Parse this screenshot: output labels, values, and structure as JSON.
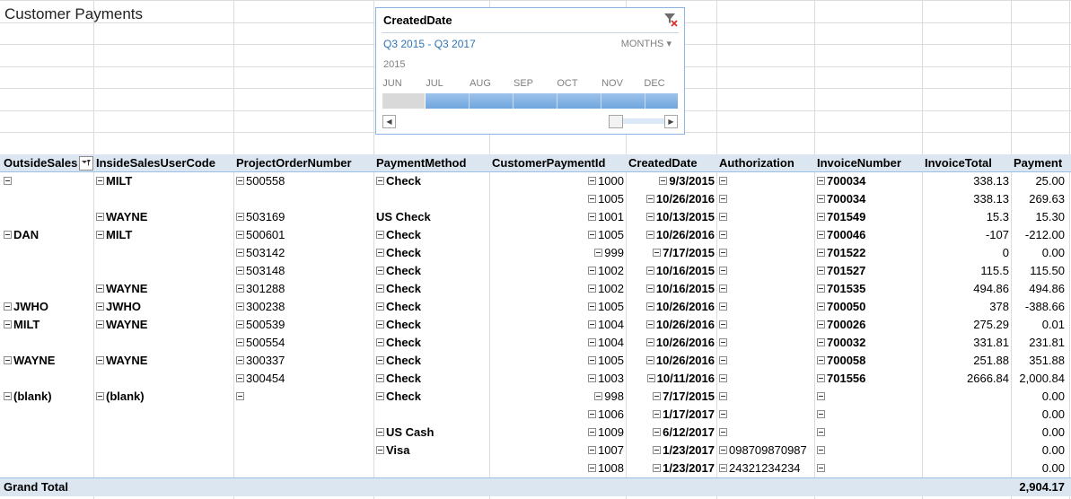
{
  "sheet": {
    "title": "Customer Payments"
  },
  "slicer": {
    "header": "CreatedDate",
    "range_label": "Q3 2015 - Q3 2017",
    "time_level": "MONTHS",
    "year": "2015",
    "months": [
      "JUN",
      "JUL",
      "AUG",
      "SEP",
      "OCT",
      "NOV",
      "DEC"
    ]
  },
  "pivot": {
    "headers": [
      "OutsideSales",
      "InsideSalesUserCode",
      "ProjectOrderNumber",
      "PaymentMethod",
      "CustomerPaymentId",
      "CreatedDate",
      "Authorization",
      "InvoiceNumber",
      "InvoiceTotal",
      "Payment"
    ],
    "rows": [
      {
        "outside": "",
        "outside_exp": true,
        "inside": "MILT",
        "inside_exp": true,
        "order": "500558",
        "order_exp": true,
        "method": "Check",
        "method_exp": true,
        "pid": "1000",
        "date": "9/3/2015",
        "auth": "",
        "auth_exp": true,
        "invoice": "700034",
        "invoice_exp": true,
        "total": "338.13",
        "payment": "25.00"
      },
      {
        "outside": "",
        "outside_exp": false,
        "inside": "",
        "inside_exp": false,
        "order": "",
        "order_exp": false,
        "method": "",
        "method_exp": false,
        "pid": "1005",
        "date": "10/26/2016",
        "auth": "",
        "auth_exp": true,
        "invoice": "700034",
        "invoice_exp": true,
        "total": "338.13",
        "payment": "269.63"
      },
      {
        "outside": "",
        "outside_exp": false,
        "inside": "WAYNE",
        "inside_exp": true,
        "order": "503169",
        "order_exp": true,
        "method": "US Check",
        "method_exp": false,
        "pid": "1001",
        "date": "10/13/2015",
        "auth": "",
        "auth_exp": true,
        "invoice": "701549",
        "invoice_exp": true,
        "total": "15.3",
        "payment": "15.30"
      },
      {
        "outside": "DAN",
        "outside_exp": true,
        "inside": "MILT",
        "inside_exp": true,
        "order": "500601",
        "order_exp": true,
        "method": "Check",
        "method_exp": true,
        "pid": "1005",
        "date": "10/26/2016",
        "auth": "",
        "auth_exp": true,
        "invoice": "700046",
        "invoice_exp": true,
        "total": "-107",
        "payment": "-212.00"
      },
      {
        "outside": "",
        "outside_exp": false,
        "inside": "",
        "inside_exp": false,
        "order": "503142",
        "order_exp": true,
        "method": "Check",
        "method_exp": true,
        "pid": "999",
        "date": "7/17/2015",
        "auth": "",
        "auth_exp": true,
        "invoice": "701522",
        "invoice_exp": true,
        "total": "0",
        "payment": "0.00"
      },
      {
        "outside": "",
        "outside_exp": false,
        "inside": "",
        "inside_exp": false,
        "order": "503148",
        "order_exp": true,
        "method": "Check",
        "method_exp": true,
        "pid": "1002",
        "date": "10/16/2015",
        "auth": "",
        "auth_exp": true,
        "invoice": "701527",
        "invoice_exp": true,
        "total": "115.5",
        "payment": "115.50"
      },
      {
        "outside": "",
        "outside_exp": false,
        "inside": "WAYNE",
        "inside_exp": true,
        "order": "301288",
        "order_exp": true,
        "method": "Check",
        "method_exp": true,
        "pid": "1002",
        "date": "10/16/2015",
        "auth": "",
        "auth_exp": true,
        "invoice": "701535",
        "invoice_exp": true,
        "total": "494.86",
        "payment": "494.86"
      },
      {
        "outside": "JWHO",
        "outside_exp": true,
        "inside": "JWHO",
        "inside_exp": true,
        "order": "300238",
        "order_exp": true,
        "method": "Check",
        "method_exp": true,
        "pid": "1005",
        "date": "10/26/2016",
        "auth": "",
        "auth_exp": true,
        "invoice": "700050",
        "invoice_exp": true,
        "total": "378",
        "payment": "-388.66"
      },
      {
        "outside": "MILT",
        "outside_exp": true,
        "inside": "WAYNE",
        "inside_exp": true,
        "order": "500539",
        "order_exp": true,
        "method": "Check",
        "method_exp": true,
        "pid": "1004",
        "date": "10/26/2016",
        "auth": "",
        "auth_exp": true,
        "invoice": "700026",
        "invoice_exp": true,
        "total": "275.29",
        "payment": "0.01"
      },
      {
        "outside": "",
        "outside_exp": false,
        "inside": "",
        "inside_exp": false,
        "order": "500554",
        "order_exp": true,
        "method": "Check",
        "method_exp": true,
        "pid": "1004",
        "date": "10/26/2016",
        "auth": "",
        "auth_exp": true,
        "invoice": "700032",
        "invoice_exp": true,
        "total": "331.81",
        "payment": "231.81"
      },
      {
        "outside": "WAYNE",
        "outside_exp": true,
        "inside": "WAYNE",
        "inside_exp": true,
        "order": "300337",
        "order_exp": true,
        "method": "Check",
        "method_exp": true,
        "pid": "1005",
        "date": "10/26/2016",
        "auth": "",
        "auth_exp": true,
        "invoice": "700058",
        "invoice_exp": true,
        "total": "251.88",
        "payment": "351.88"
      },
      {
        "outside": "",
        "outside_exp": false,
        "inside": "",
        "inside_exp": false,
        "order": "300454",
        "order_exp": true,
        "method": "Check",
        "method_exp": true,
        "pid": "1003",
        "date": "10/11/2016",
        "auth": "",
        "auth_exp": true,
        "invoice": "701556",
        "invoice_exp": true,
        "total": "2666.84",
        "payment": "2,000.84"
      },
      {
        "outside": "(blank)",
        "outside_exp": true,
        "inside": "(blank)",
        "inside_exp": true,
        "order": "",
        "order_exp": true,
        "method": "Check",
        "method_exp": true,
        "pid": "998",
        "date": "7/17/2015",
        "auth": "",
        "auth_exp": true,
        "invoice": "",
        "invoice_exp": true,
        "total": "",
        "payment": "0.00"
      },
      {
        "outside": "",
        "outside_exp": false,
        "inside": "",
        "inside_exp": false,
        "order": "",
        "order_exp": false,
        "method": "",
        "method_exp": false,
        "pid": "1006",
        "date": "1/17/2017",
        "auth": "",
        "auth_exp": true,
        "invoice": "",
        "invoice_exp": true,
        "total": "",
        "payment": "0.00"
      },
      {
        "outside": "",
        "outside_exp": false,
        "inside": "",
        "inside_exp": false,
        "order": "",
        "order_exp": false,
        "method": "US Cash",
        "method_exp": true,
        "pid": "1009",
        "date": "6/12/2017",
        "auth": "",
        "auth_exp": true,
        "invoice": "",
        "invoice_exp": true,
        "total": "",
        "payment": "0.00"
      },
      {
        "outside": "",
        "outside_exp": false,
        "inside": "",
        "inside_exp": false,
        "order": "",
        "order_exp": false,
        "method": "Visa",
        "method_exp": true,
        "pid": "1007",
        "date": "1/23/2017",
        "auth": "098709870987",
        "auth_exp": true,
        "invoice": "",
        "invoice_exp": true,
        "total": "",
        "payment": "0.00"
      },
      {
        "outside": "",
        "outside_exp": false,
        "inside": "",
        "inside_exp": false,
        "order": "",
        "order_exp": false,
        "method": "",
        "method_exp": false,
        "pid": "1008",
        "date": "1/23/2017",
        "auth": "24321234234",
        "auth_exp": true,
        "invoice": "",
        "invoice_exp": true,
        "total": "",
        "payment": "0.00"
      }
    ],
    "grand_total_label": "Grand Total",
    "grand_total_value": "2,904.17"
  },
  "colors": {
    "header_fill": "#dce6f1",
    "gridline": "#dadcdd",
    "slicer_border": "#8db3e2",
    "slicer_selected": "#6fa5de"
  }
}
